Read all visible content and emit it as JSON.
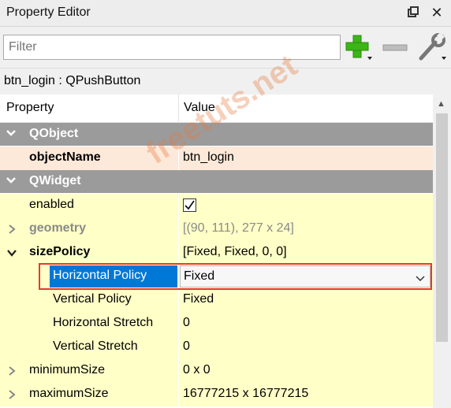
{
  "window": {
    "title": "Property Editor"
  },
  "toolbar": {
    "filter_placeholder": "Filter"
  },
  "object_line": "btn_login : QPushButton",
  "columns": {
    "property": "Property",
    "value": "Value"
  },
  "groups": {
    "qobject": "QObject",
    "qwidget": "QWidget"
  },
  "props": {
    "objectName": {
      "label": "objectName",
      "value": "btn_login"
    },
    "enabled": {
      "label": "enabled",
      "checked": true
    },
    "geometry": {
      "label": "geometry",
      "value": "[(90, 111), 277 x 24]"
    },
    "sizePolicy": {
      "label": "sizePolicy",
      "value": "[Fixed, Fixed, 0, 0]"
    },
    "horizontalPolicy": {
      "label": "Horizontal Policy",
      "value": "Fixed"
    },
    "verticalPolicy": {
      "label": "Vertical Policy",
      "value": "Fixed"
    },
    "horizontalStretch": {
      "label": "Horizontal Stretch",
      "value": "0"
    },
    "verticalStretch": {
      "label": "Vertical Stretch",
      "value": "0"
    },
    "minimumSize": {
      "label": "minimumSize",
      "value": "0 x 0"
    },
    "maximumSize": {
      "label": "maximumSize",
      "value": "16777215 x 16777215"
    }
  },
  "watermark": "freetuts.net",
  "colors": {
    "group_bg": "#9b9b9b",
    "row_yellow": "#ffffc8",
    "row_peach": "#fde9d9",
    "selection": "#0078d7",
    "highlight_border": "#e53935",
    "add_icon": "#3cb517"
  },
  "icons": [
    "float-icon",
    "close-icon",
    "add-icon",
    "remove-icon",
    "configure-icon",
    "collapse-arrow-icon",
    "expand-arrow-icon",
    "checkbox-checked-icon",
    "dropdown-chevron-icon"
  ]
}
